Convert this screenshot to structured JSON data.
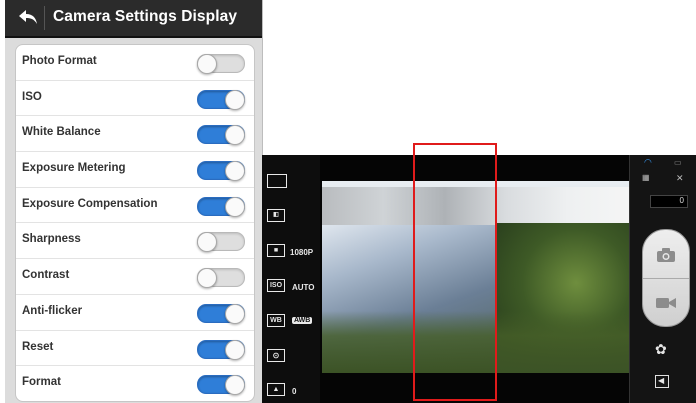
{
  "header": {
    "title": "Camera Settings Display"
  },
  "settings": [
    {
      "label": "Photo Format",
      "on": false
    },
    {
      "label": "ISO",
      "on": true
    },
    {
      "label": "White Balance",
      "on": true
    },
    {
      "label": "Exposure Metering",
      "on": true
    },
    {
      "label": "Exposure Compensation",
      "on": true
    },
    {
      "label": "Sharpness",
      "on": false
    },
    {
      "label": "Contrast",
      "on": false
    },
    {
      "label": "Anti-flicker",
      "on": true
    },
    {
      "label": "Reset",
      "on": true
    },
    {
      "label": "Format",
      "on": true
    }
  ],
  "camera": {
    "resolution_label": "1080P",
    "iso_icon_label": "ISO",
    "iso_value": "AUTO",
    "wb_icon_label": "WB",
    "wb_value": "AWB",
    "exposure_value": "0",
    "shot_counter": "0"
  },
  "colors": {
    "toggle_on": "#2f7ed8",
    "toggle_off": "#dedede",
    "highlight_box": "#e01b1b"
  }
}
